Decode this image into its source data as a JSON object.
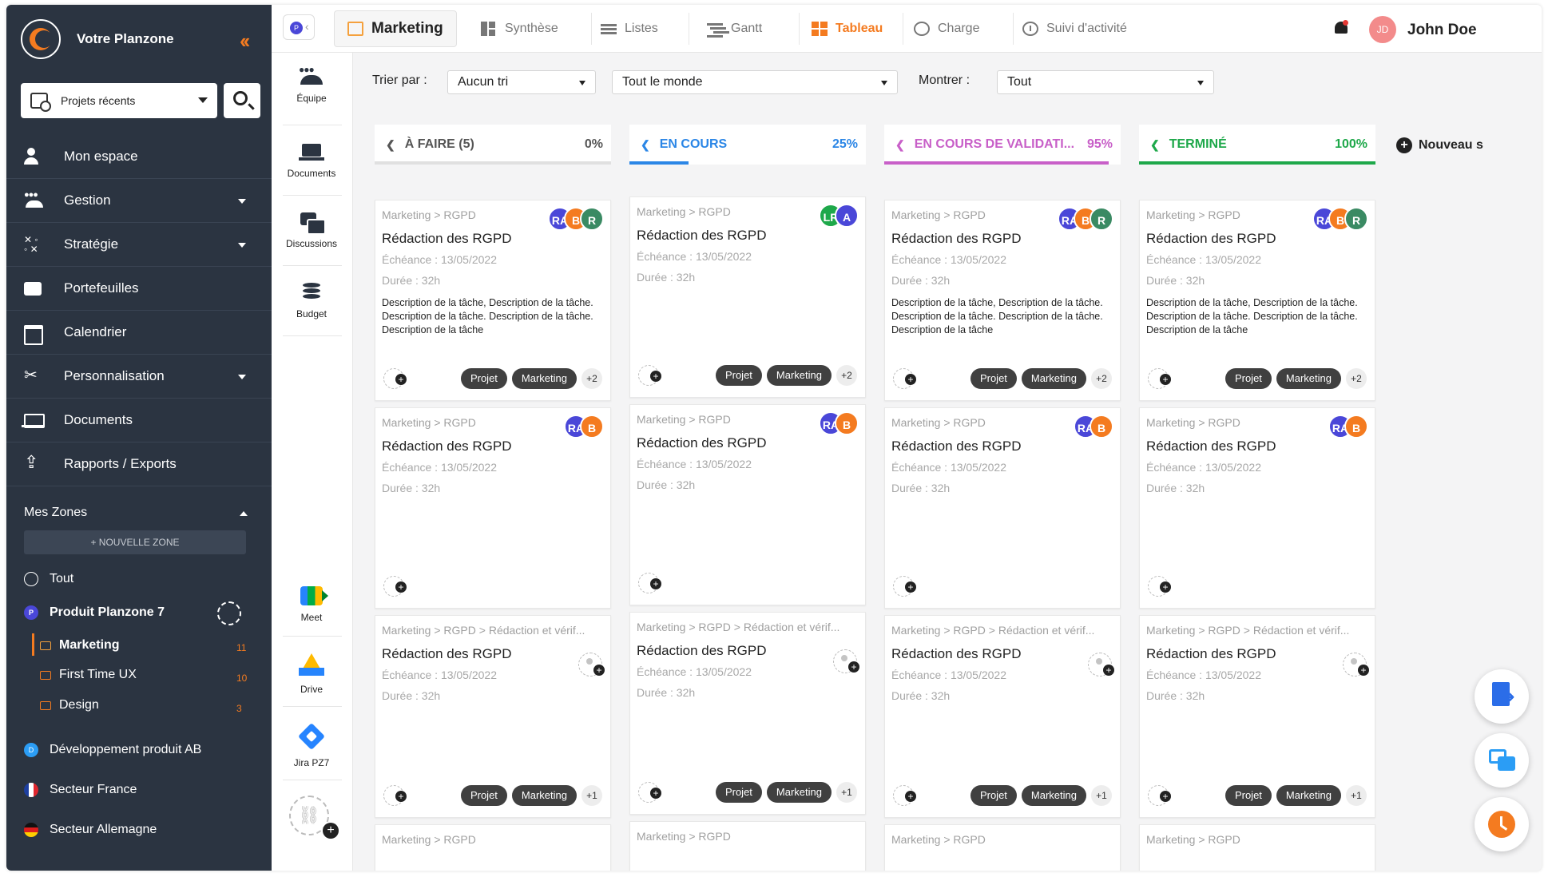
{
  "sidebar": {
    "brand": "Votre Planzone",
    "recent_projects": "Projets récents",
    "nav": [
      {
        "label": "Mon espace",
        "icon": "user-icon",
        "has_dropdown": false
      },
      {
        "label": "Gestion",
        "icon": "users-icon",
        "has_dropdown": true
      },
      {
        "label": "Stratégie",
        "icon": "strategy-icon",
        "has_dropdown": true
      },
      {
        "label": "Portefeuilles",
        "icon": "folder-icon",
        "has_dropdown": false
      },
      {
        "label": "Calendrier",
        "icon": "calendar-icon",
        "has_dropdown": false
      },
      {
        "label": "Personnalisation",
        "icon": "tools-icon",
        "has_dropdown": true
      },
      {
        "label": "Documents",
        "icon": "laptop-icon",
        "has_dropdown": false
      },
      {
        "label": "Rapports / Exports",
        "icon": "export-icon",
        "has_dropdown": false
      }
    ],
    "zones_title": "Mes Zones",
    "new_zone": "+ NOUVELLE ZONE",
    "all": "Tout",
    "project": {
      "badge": "P",
      "name": "Produit Planzone 7"
    },
    "folders": [
      {
        "name": "Marketing",
        "count": "11"
      },
      {
        "name": "First Time UX",
        "count": "10"
      },
      {
        "name": "Design",
        "count": "3"
      }
    ],
    "other_zones": [
      {
        "badge": "D",
        "name": "Développement produit AB"
      },
      {
        "name": "Secteur France",
        "flag": "fr"
      },
      {
        "name": "Secteur Allemagne",
        "flag": "de"
      }
    ]
  },
  "topbar": {
    "project_badge": "P",
    "tabs": [
      {
        "label": "Marketing",
        "icon": "folder-icon"
      },
      {
        "label": "Synthèse",
        "icon": "synthesis-icon"
      },
      {
        "label": "Listes",
        "icon": "list-icon"
      },
      {
        "label": "Gantt",
        "icon": "gantt-icon"
      },
      {
        "label": "Tableau",
        "icon": "board-icon"
      },
      {
        "label": "Charge",
        "icon": "gauge-icon"
      },
      {
        "label": "Suivi d'activité",
        "icon": "clock-icon"
      }
    ],
    "user_initials": "JD",
    "user_name": "John Doe"
  },
  "rail": {
    "items": [
      "Équipe",
      "Documents",
      "Discussions",
      "Budget"
    ],
    "integrations": [
      "Meet",
      "Drive",
      "Jira PZ7"
    ]
  },
  "filters": {
    "sort_label": "Trier par :",
    "sort_value": "Aucun tri",
    "people_value": "Tout le monde",
    "show_label": "Montrer :",
    "show_value": "Tout"
  },
  "columns": [
    {
      "title": "À FAIRE (5)",
      "pct": "0%",
      "progress": 0,
      "color": "#555555",
      "bar": "#e0e0e0"
    },
    {
      "title": "EN COURS",
      "pct": "25%",
      "progress": 25,
      "color": "#2b86e6",
      "bar": "#2b86e6"
    },
    {
      "title": "EN COURS DE VALIDATI...",
      "pct": "95%",
      "progress": 95,
      "color": "#c85fc8",
      "bar": "#c85fc8"
    },
    {
      "title": "TERMINÉ",
      "pct": "100%",
      "progress": 100,
      "color": "#1ea84a",
      "bar": "#1ea84a"
    }
  ],
  "new_column": "Nouveau s",
  "card": {
    "crumb": "Marketing > RGPD",
    "crumb_long": "Marketing > RGPD > Rédaction et vérif...",
    "title": "Rédaction des RGPD",
    "due": "Échéance : 13/05/2022",
    "duration": "Durée : 32h",
    "description": "Description de la tâche, Description de la tâche. Description de la tâche. Description de la tâche. Description de la tâche",
    "tag1": "Projet",
    "tag2": "Marketing",
    "more2": "+2",
    "more1": "+1"
  },
  "avatars": {
    "RA": {
      "label": "RA",
      "color": "#4a47d8"
    },
    "B": {
      "label": "B",
      "color": "#f47b20"
    },
    "R": {
      "label": "R",
      "color": "#3a8a63"
    },
    "LR": {
      "label": "LR",
      "color": "#1ea84a"
    },
    "A": {
      "label": "A",
      "color": "#4a47d8"
    }
  }
}
